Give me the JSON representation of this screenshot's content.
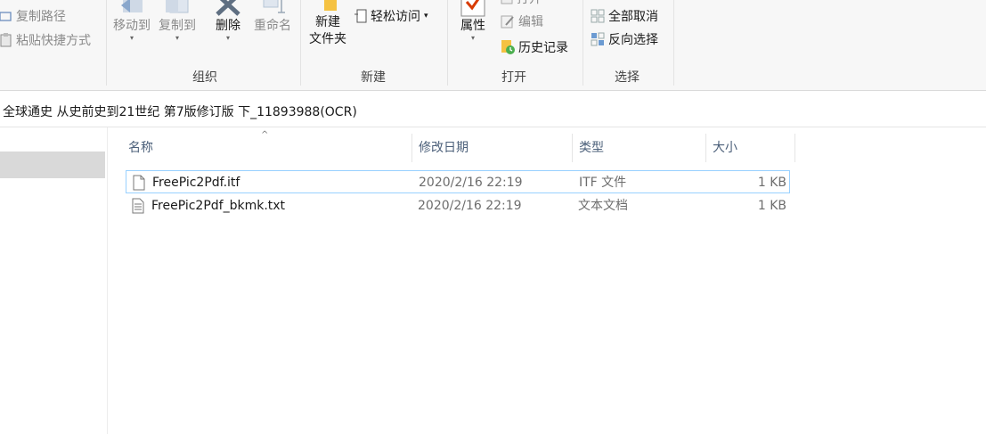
{
  "ribbon": {
    "clipboard": {
      "copy_path": "复制路径",
      "paste_shortcut": "粘贴快捷方式"
    },
    "organize": {
      "move_to": "移动到",
      "copy_to": "复制到",
      "delete": "删除",
      "rename": "重命名",
      "label": "组织"
    },
    "new": {
      "new_folder_line1": "新建",
      "new_folder_line2": "文件夹",
      "easy_access": "轻松访问",
      "label": "新建"
    },
    "open": {
      "properties": "属性",
      "open": "打开",
      "edit": "编辑",
      "history": "历史记录",
      "label": "打开"
    },
    "select": {
      "select_none": "全部取消",
      "invert": "反向选择",
      "label": "选择"
    }
  },
  "address": {
    "path": "全球通史 从史前史到21世纪 第7版修订版 下_11893988(OCR)"
  },
  "columns": {
    "name": "名称",
    "date": "修改日期",
    "type": "类型",
    "size": "大小"
  },
  "files": [
    {
      "name": "FreePic2Pdf.itf",
      "date": "2020/2/16 22:19",
      "type": "ITF 文件",
      "size": "1 KB",
      "icon": "blank-file-icon"
    },
    {
      "name": "FreePic2Pdf_bkmk.txt",
      "date": "2020/2/16 22:19",
      "type": "文本文档",
      "size": "1 KB",
      "icon": "text-file-icon"
    }
  ],
  "colors": {
    "selected_row_border": "#99d1ff",
    "header_text": "#4c607a",
    "nav_selected": "#d9d9d9"
  }
}
